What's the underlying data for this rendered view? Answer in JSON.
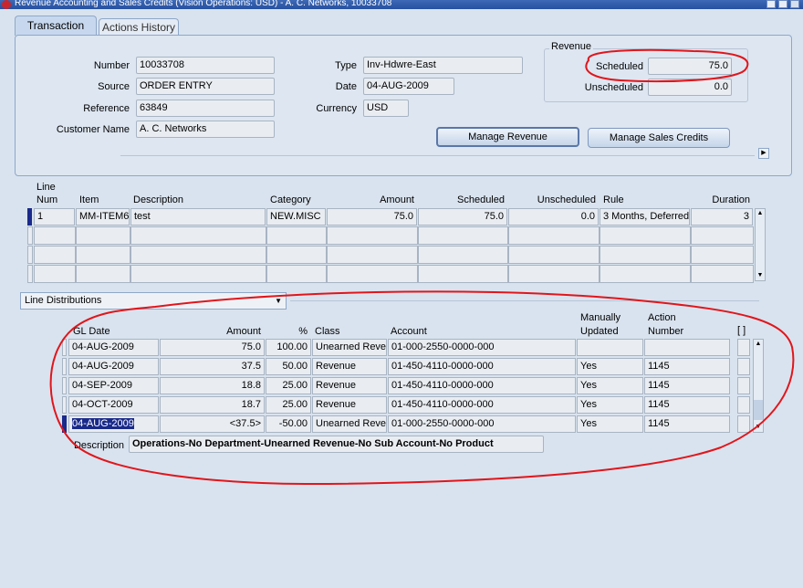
{
  "window": {
    "title": "Revenue Accounting and Sales Credits (Vision Operations: USD) - A. C. Networks, 10033708"
  },
  "tabs": [
    {
      "label": "Transaction",
      "active": true
    },
    {
      "label": "Actions History",
      "active": false
    }
  ],
  "header": {
    "number_label": "Number",
    "number": "10033708",
    "source_label": "Source",
    "source": "ORDER ENTRY",
    "reference_label": "Reference",
    "reference": "63849",
    "customer_label": "Customer Name",
    "customer": "A. C. Networks",
    "type_label": "Type",
    "type": "Inv-Hdwre-East",
    "date_label": "Date",
    "date": "04-AUG-2009",
    "currency_label": "Currency",
    "currency": "USD"
  },
  "revenue": {
    "title": "Revenue",
    "scheduled_label": "Scheduled",
    "scheduled": "75.0",
    "unscheduled_label": "Unscheduled",
    "unscheduled": "0.0"
  },
  "buttons": {
    "manage_revenue": "Manage Revenue",
    "manage_sales_credits": "Manage Sales Credits"
  },
  "lines": {
    "headers": {
      "line_num_1": "Line",
      "line_num_2": "Num",
      "item": "Item",
      "description": "Description",
      "category": "Category",
      "amount": "Amount",
      "scheduled": "Scheduled",
      "unscheduled": "Unscheduled",
      "rule": "Rule",
      "duration": "Duration"
    },
    "rows": [
      {
        "num": "1",
        "item": "MM-ITEM6",
        "description": "test",
        "category": "NEW.MISC",
        "amount": "75.0",
        "scheduled": "75.0",
        "unscheduled": "0.0",
        "rule": "3 Months, Deferred",
        "duration": "3"
      }
    ]
  },
  "distributions": {
    "selector": "Line Distributions",
    "headers": {
      "gl_date": "GL Date",
      "amount": "Amount",
      "pct": "%",
      "class": "Class",
      "account": "Account",
      "manually_1": "Manually",
      "manually_2": "Updated",
      "action_1": "Action",
      "action_2": "Number",
      "folder": "[ ]"
    },
    "rows": [
      {
        "gl_date": "04-AUG-2009",
        "amount": "75.0",
        "pct": "100.00",
        "class": "Unearned Rever",
        "account": "01-000-2550-0000-000",
        "manual": "",
        "action": ""
      },
      {
        "gl_date": "04-AUG-2009",
        "amount": "37.5",
        "pct": "50.00",
        "class": "Revenue",
        "account": "01-450-4110-0000-000",
        "manual": "Yes",
        "action": "1145"
      },
      {
        "gl_date": "04-SEP-2009",
        "amount": "18.8",
        "pct": "25.00",
        "class": "Revenue",
        "account": "01-450-4110-0000-000",
        "manual": "Yes",
        "action": "1145"
      },
      {
        "gl_date": "04-OCT-2009",
        "amount": "18.7",
        "pct": "25.00",
        "class": "Revenue",
        "account": "01-450-4110-0000-000",
        "manual": "Yes",
        "action": "1145"
      },
      {
        "gl_date": "04-AUG-2009",
        "amount": "<37.5>",
        "pct": "-50.00",
        "class": "Unearned Rever",
        "account": "01-000-2550-0000-000",
        "manual": "Yes",
        "action": "1145"
      }
    ],
    "description_label": "Description",
    "description": "Operations-No Department-Unearned Revenue-No Sub Account-No Product"
  },
  "annotation_color": "#e0161b"
}
